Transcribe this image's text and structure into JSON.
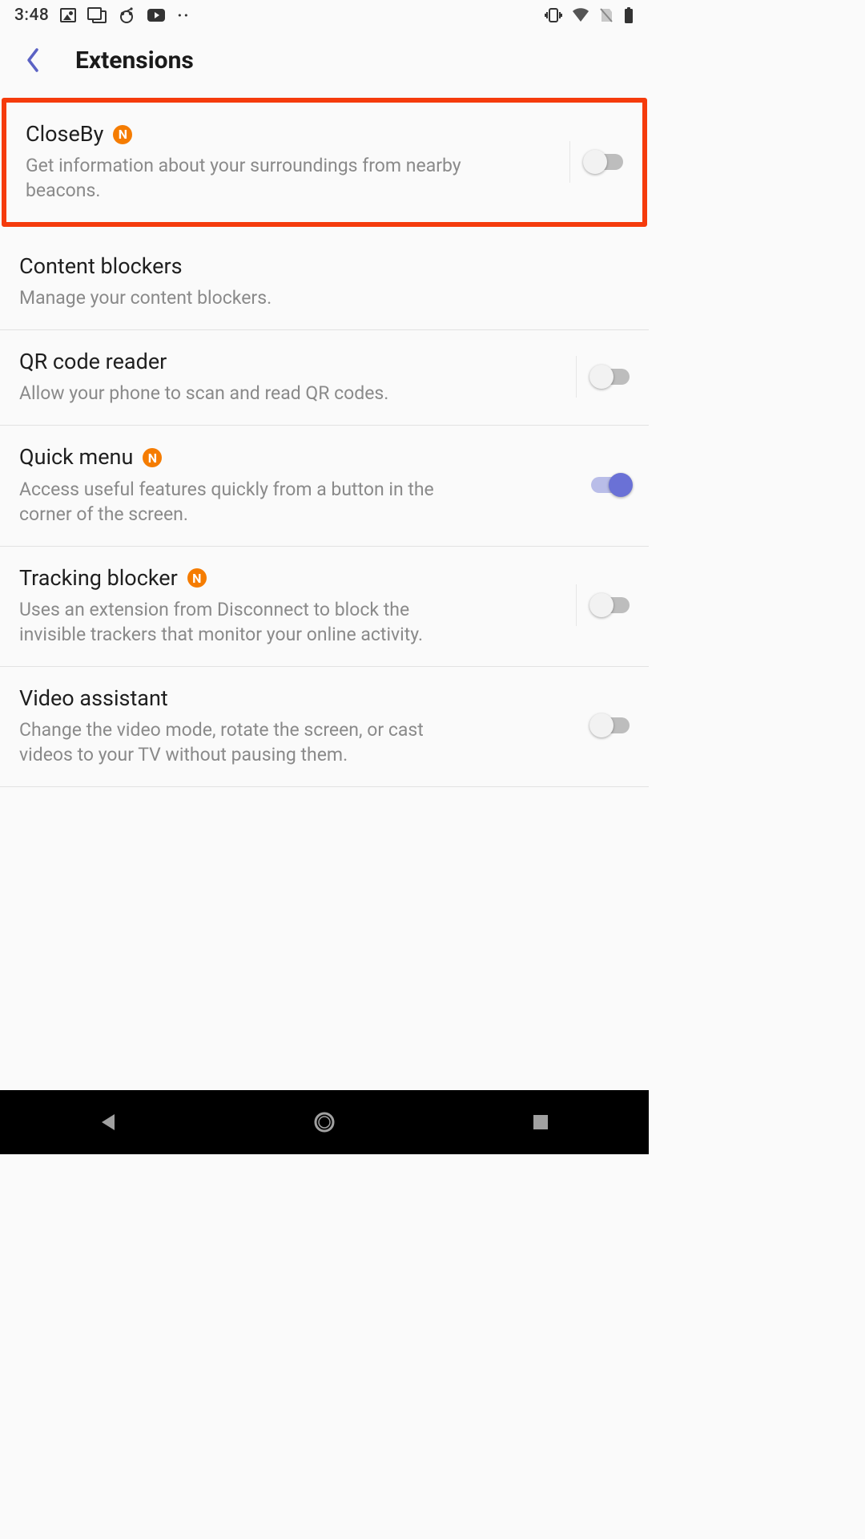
{
  "status": {
    "time": "3:48"
  },
  "header": {
    "title": "Extensions"
  },
  "badge": {
    "letter": "N"
  },
  "extensions": [
    {
      "title": "CloseBy",
      "desc": "Get information about your surroundings from nearby beacons.",
      "badge": true,
      "toggle": "off",
      "highlighted": true
    },
    {
      "title": "Content blockers",
      "desc": "Manage your content blockers.",
      "badge": false,
      "toggle": "none"
    },
    {
      "title": "QR code reader",
      "desc": "Allow your phone to scan and read QR codes.",
      "badge": false,
      "toggle": "off"
    },
    {
      "title": "Quick menu",
      "desc": "Access useful features quickly from a button in the corner of the screen.",
      "badge": true,
      "toggle": "on"
    },
    {
      "title": "Tracking blocker",
      "desc": "Uses an extension from Disconnect to block the invisible trackers that monitor your online activity.",
      "badge": true,
      "toggle": "off"
    },
    {
      "title": "Video assistant",
      "desc": "Change the video mode, rotate the screen, or cast videos to your TV without pausing them.",
      "badge": false,
      "toggle": "off"
    }
  ]
}
